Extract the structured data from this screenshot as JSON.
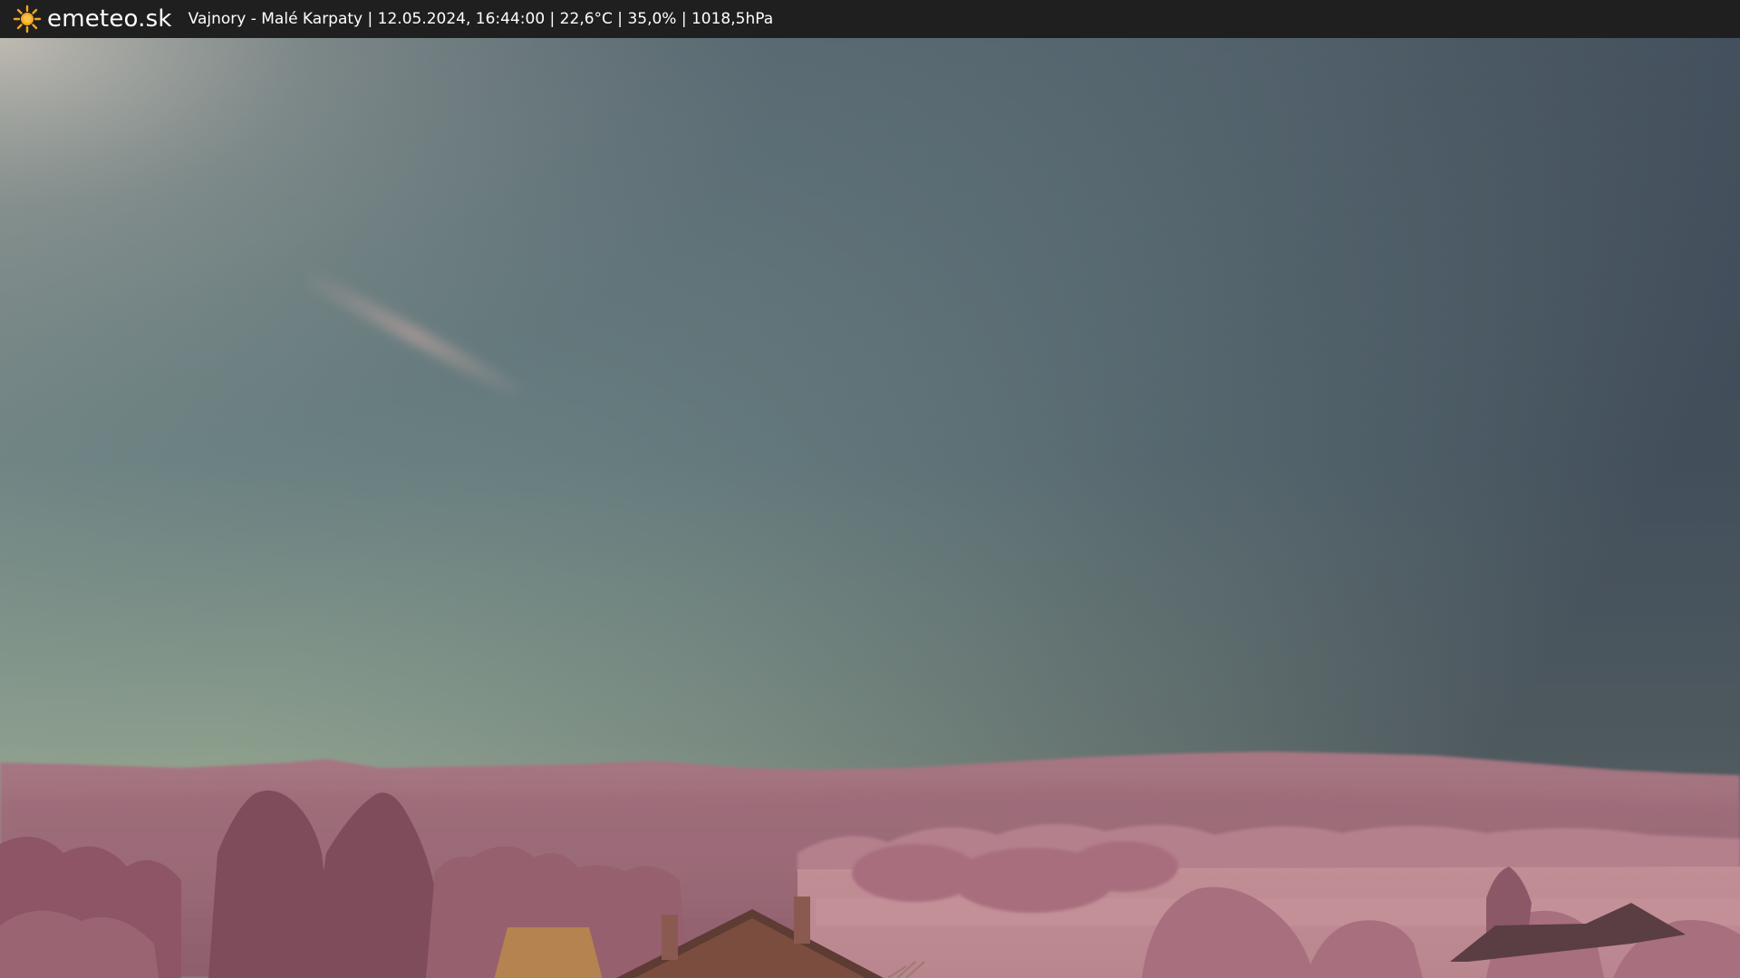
{
  "header": {
    "logo_text": "emeteo.sk",
    "caption": "Vajnory - Malé Karpaty | 12.05.2024, 16:44:00 | 22,6°C | 35,0% | 1018,5hPa"
  },
  "icons": {
    "logo": "sun-icon"
  },
  "colors": {
    "bar_bg": "#1f1f1f",
    "logo_sun": "#f5a623",
    "sky_top_right": "#3c4654",
    "sky_horizon": "#a3ad8f",
    "foliage": "#b27a88"
  }
}
